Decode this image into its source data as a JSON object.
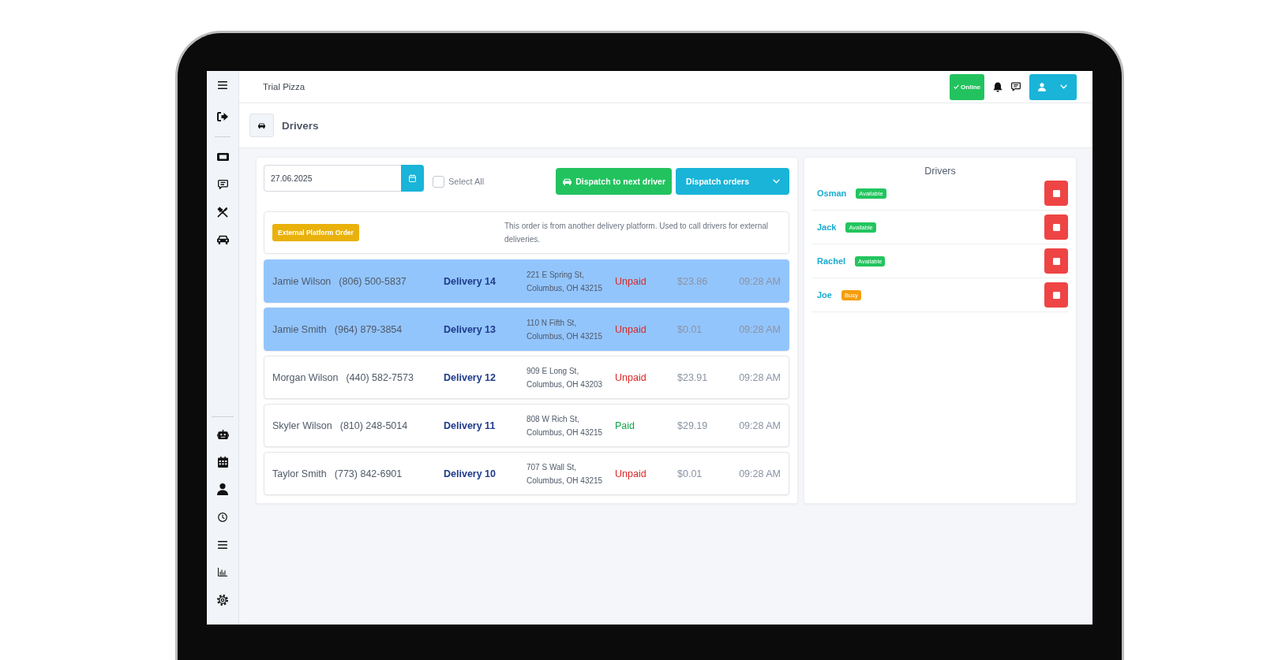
{
  "header": {
    "title": "Trial Pizza",
    "status_button": "Online"
  },
  "page_header": {
    "title": "Drivers"
  },
  "orders_panel": {
    "date_field": {
      "value": "27.06.2025"
    },
    "select_all": {
      "label": "Select All",
      "checked": false
    },
    "buttons": [
      {
        "label": "Dispatch to next driver",
        "kind": "dispatch"
      },
      {
        "label": "Dispatch orders",
        "kind": "dropdown"
      }
    ],
    "notice": {
      "badge": "External Platform Order",
      "text": "This order is from another delivery platform. Used to call drivers for external deliveries."
    },
    "orders": [
      {
        "customer": "Jamie Wilson",
        "phone": "(806) 500-5837",
        "delivery": "Delivery 14",
        "address": [
          "221 E Spring St,",
          "Columbus, OH 43215"
        ],
        "payment": "Unpaid",
        "paid": false,
        "total": "$23.86",
        "time": "09:28 AM",
        "selected": true
      },
      {
        "customer": "Jamie Smith",
        "phone": "(964) 879-3854",
        "delivery": "Delivery 13",
        "address": [
          "110 N Fifth St,",
          "Columbus, OH 43215"
        ],
        "payment": "Unpaid",
        "paid": false,
        "total": "$0.01",
        "time": "09:28 AM",
        "selected": true
      },
      {
        "customer": "Morgan Wilson",
        "phone": "(440) 582-7573",
        "delivery": "Delivery 12",
        "address": [
          "909 E Long St,",
          "Columbus, OH 43203"
        ],
        "payment": "Unpaid",
        "paid": false,
        "total": "$23.91",
        "time": "09:28 AM",
        "selected": false
      },
      {
        "customer": "Skyler Wilson",
        "phone": "(810) 248-5014",
        "delivery": "Delivery 11",
        "address": [
          "808 W Rich St,",
          "Columbus, OH 43215"
        ],
        "payment": "Paid",
        "paid": true,
        "total": "$29.19",
        "time": "09:28 AM",
        "selected": false
      },
      {
        "customer": "Taylor Smith",
        "phone": "(773) 842-6901",
        "delivery": "Delivery 10",
        "address": [
          "707 S Wall St,",
          "Columbus, OH 43215"
        ],
        "payment": "Unpaid",
        "paid": false,
        "total": "$0.01",
        "time": "09:28 AM",
        "selected": false
      }
    ]
  },
  "drivers_panel": {
    "title": "Drivers",
    "drivers": [
      {
        "name": "Osman",
        "status": "Available",
        "color": "#22c55e"
      },
      {
        "name": "Jack",
        "status": "Available",
        "color": "#22c55e"
      },
      {
        "name": "Rachel",
        "status": "Available",
        "color": "#22c55e"
      },
      {
        "name": "Joe",
        "status": "Busy",
        "color": "#f59e0b"
      }
    ]
  }
}
